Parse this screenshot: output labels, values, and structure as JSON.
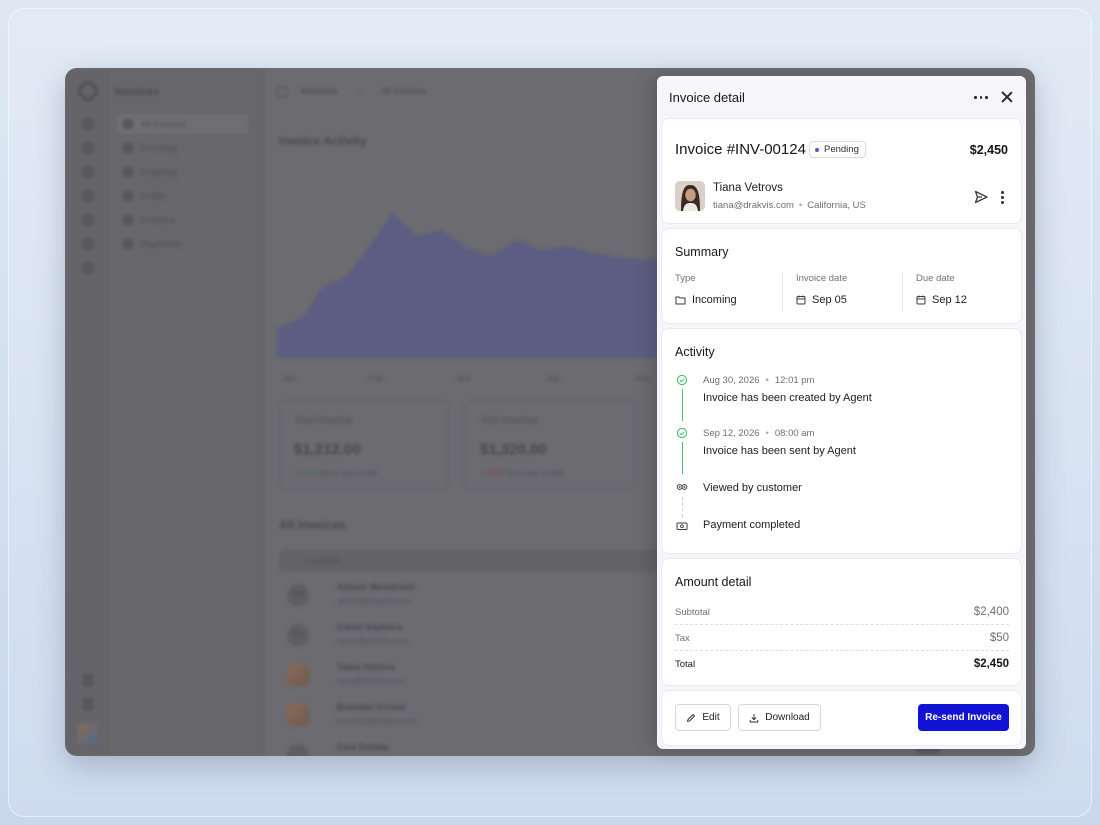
{
  "background_app": {
    "app_title": "Invoices",
    "breadcrumb": [
      "Invoices",
      "All Invoices"
    ],
    "sidebar_items": [
      "All Invoices",
      "Incoming",
      "Outgoing",
      "Drafts",
      "Overdue",
      "Payments"
    ],
    "heading": "Invoice Activity",
    "x_ticks": [
      "Jan",
      "Feb",
      "Mar",
      "Apr",
      "May"
    ],
    "stats": [
      {
        "label": "Total Outgoing",
        "value": "$1,212.00",
        "delta": "↑ 12%",
        "note": "Since last month"
      },
      {
        "label": "Total Incoming",
        "value": "$1,320.00",
        "delta": "↓ 10%",
        "note": "Since last month"
      }
    ],
    "all_invoices_heading": "All Invoices",
    "table_header": "Customer",
    "rows": [
      {
        "initials": "AM",
        "name": "Allison Westervelt",
        "email": "allison@drakvis.com"
      },
      {
        "initials": "CS",
        "name": "Carter Saphera",
        "email": "carter@drakvis.com"
      },
      {
        "initials": "",
        "name": "Tiana Vetrovs",
        "email": "tiana@drakvis.com"
      },
      {
        "initials": "",
        "name": "Brandon Korsor",
        "email": "brandon@drakvis.com"
      },
      {
        "initials": "",
        "name": "Zara Doleda",
        "email": "zara@drakvis.com"
      }
    ]
  },
  "drawer": {
    "title": "Invoice detail",
    "invoice": {
      "number": "Invoice #INV-00124",
      "status": "Pending",
      "amount": "$2,450",
      "customer_name": "Tiana Vetrovs",
      "customer_email": "tiana@drakvis.com",
      "customer_location": "California, US"
    },
    "summary": {
      "title": "Summary",
      "type_label": "Type",
      "type_value": "Incoming",
      "invoice_date_label": "Invoice date",
      "invoice_date_value": "Sep 05",
      "due_date_label": "Due date",
      "due_date_value": "Sep 12"
    },
    "activity": {
      "title": "Activity",
      "events": [
        {
          "date": "Aug 30, 2026",
          "time": "12:01 pm",
          "text": "Invoice has been created by Agent",
          "icon": "check-circle-icon",
          "done": true
        },
        {
          "date": "Sep 12, 2026",
          "time": "08:00 am",
          "text": "Invoice has been sent by Agent",
          "icon": "check-circle-icon",
          "done": true
        },
        {
          "date": "",
          "time": "",
          "text": "Viewed by customer",
          "icon": "eye-icon",
          "done": false
        },
        {
          "date": "",
          "time": "",
          "text": "Payment completed",
          "icon": "cash-icon",
          "done": false
        }
      ]
    },
    "amount_detail": {
      "title": "Amount detail",
      "subtotal_label": "Subtotal",
      "subtotal_value": "$2,400",
      "tax_label": "Tax",
      "tax_value": "$50",
      "total_label": "Total",
      "total_value": "$2,450"
    },
    "actions": {
      "edit_label": "Edit",
      "download_label": "Download",
      "resend_label": "Re-send Invoice"
    }
  },
  "colors": {
    "accent": "#1313d6",
    "success": "#45c16b",
    "pending_dot": "#7048d8",
    "overlay": "#6b6b70"
  }
}
